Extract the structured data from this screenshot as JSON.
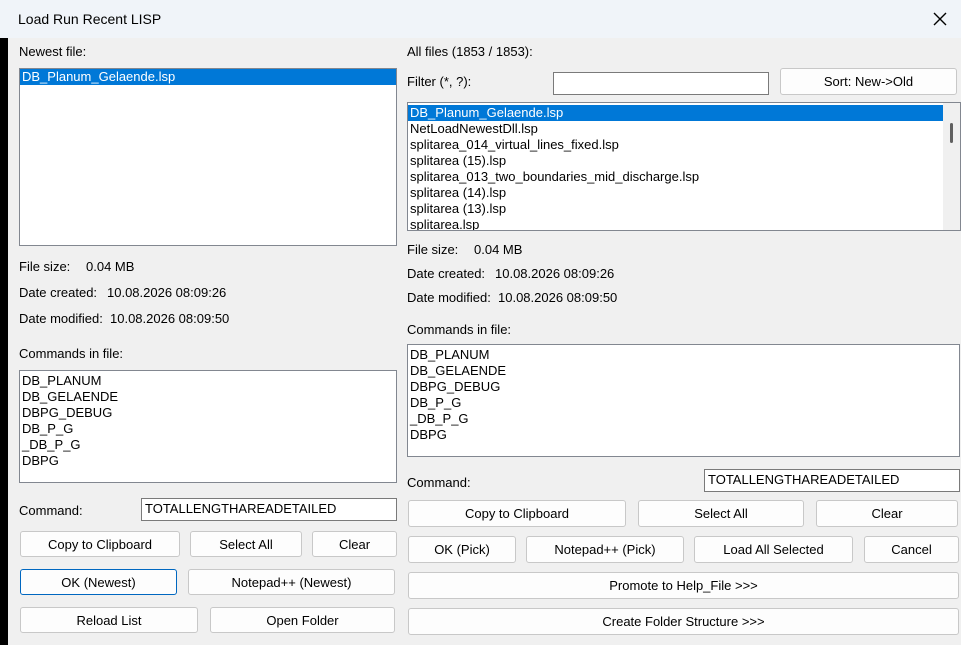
{
  "window": {
    "title": "Load  Run Recent LISP"
  },
  "left": {
    "newest_label": "Newest file:",
    "newest_files": [
      "DB_Planum_Gelaende.lsp"
    ],
    "file_size_label": "File size:",
    "file_size": "0.04 MB",
    "date_created_label": "Date created:",
    "date_created": "10.08.2026 08:09:26",
    "date_modified_label": "Date modified:",
    "date_modified": "10.08.2026 08:09:50",
    "commands_label": "Commands in file:",
    "commands": [
      "DB_PLANUM",
      "DB_GELAENDE",
      "DBPG_DEBUG",
      "DB_P_G",
      "_DB_P_G",
      "DBPG"
    ],
    "command_label": "Command:",
    "command_value": "TOTALLENGTHAREADETAILED",
    "copy_label": "Copy to Clipboard",
    "select_all_label": "Select All",
    "clear_label": "Clear",
    "ok_newest_label": "OK (Newest)",
    "notepad_newest_label": "Notepad++ (Newest)",
    "reload_label": "Reload List",
    "open_folder_label": "Open Folder"
  },
  "right": {
    "all_files_label": "All files (1853 / 1853):",
    "filter_label": "Filter (*, ?):",
    "filter_value": "",
    "sort_label": "Sort: New->Old",
    "files": [
      "DB_Planum_Gelaende.lsp",
      "NetLoadNewestDll.lsp",
      "splitarea_014_virtual_lines_fixed.lsp",
      "splitarea (15).lsp",
      "splitarea_013_two_boundaries_mid_discharge.lsp",
      "splitarea (14).lsp",
      "splitarea (13).lsp",
      "splitarea.lsp"
    ],
    "file_size_label": "File size:",
    "file_size": "0.04 MB",
    "date_created_label": "Date created:",
    "date_created": "10.08.2026 08:09:26",
    "date_modified_label": "Date modified:",
    "date_modified": "10.08.2026 08:09:50",
    "commands_label": "Commands in file:",
    "commands": [
      "DB_PLANUM",
      "DB_GELAENDE",
      "DBPG_DEBUG",
      "DB_P_G",
      "_DB_P_G",
      "DBPG"
    ],
    "command_label": "Command:",
    "command_value": "TOTALLENGTHAREADETAILED",
    "copy_label": "Copy to Clipboard",
    "select_all_label": "Select All",
    "clear_label": "Clear",
    "ok_pick_label": "OK (Pick)",
    "notepad_pick_label": "Notepad++ (Pick)",
    "load_all_label": "Load All Selected",
    "cancel_label": "Cancel",
    "promote_label": "Promote to Help_File >>>",
    "create_folder_label": "Create Folder Structure >>>"
  }
}
